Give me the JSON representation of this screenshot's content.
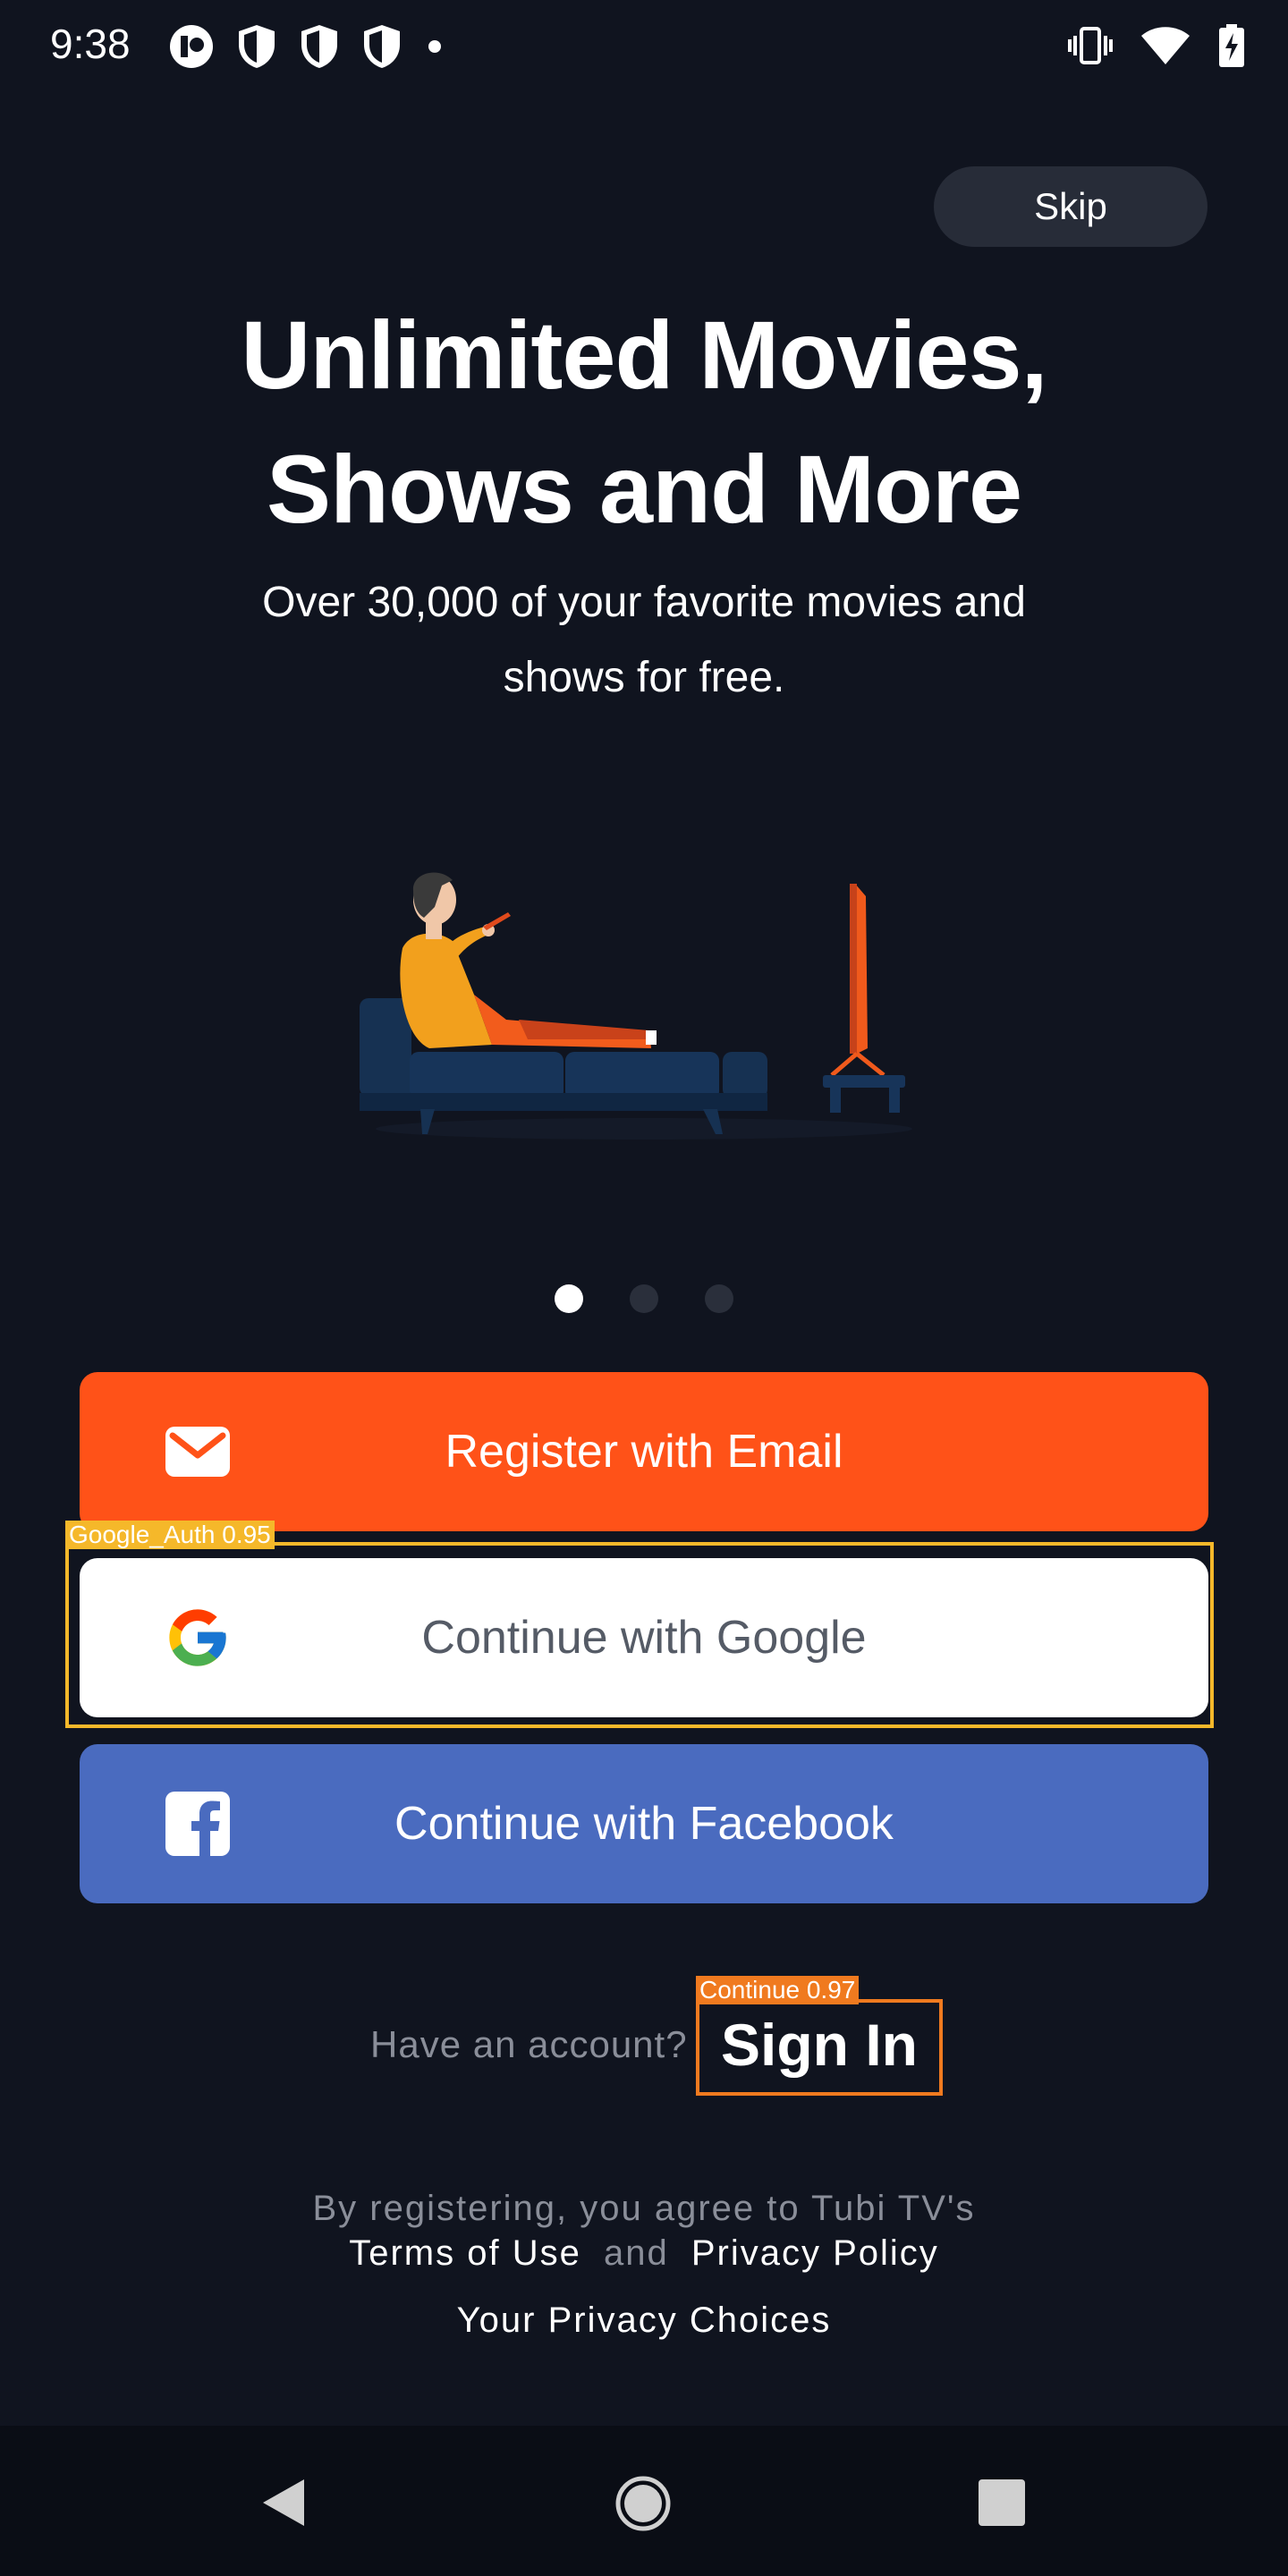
{
  "status_bar": {
    "time": "9:38",
    "left_icons": [
      "app-notification-icon",
      "shield-icon",
      "shield-icon",
      "shield-icon",
      "dot-icon"
    ],
    "right_icons": [
      "vibrate-icon",
      "wifi-icon",
      "battery-charging-icon"
    ]
  },
  "skip_label": "Skip",
  "headline": {
    "line1": "Unlimited Movies,",
    "line2": "Shows and More"
  },
  "subline": {
    "line1": "Over 30,000 of your favorite movies and",
    "line2": "shows for free."
  },
  "carousel": {
    "page_count": 3,
    "active_index": 0
  },
  "buttons": {
    "email": {
      "label": "Register with Email",
      "icon": "mail-icon",
      "color": "#ff5218"
    },
    "google": {
      "label": "Continue with Google",
      "icon": "google-icon",
      "color": "#ffffff"
    },
    "facebook": {
      "label": "Continue with Facebook",
      "icon": "facebook-icon",
      "color": "#4a6bbf"
    }
  },
  "detections": {
    "google": {
      "label": "Google_Auth 0.95",
      "color": "#f5b82a"
    },
    "sign_in": {
      "label": "Continue 0.97",
      "color": "#f07a1f"
    }
  },
  "account": {
    "prompt": "Have an account?",
    "sign_in": "Sign In"
  },
  "legal": {
    "line1": "By registering, you agree to Tubi TV's",
    "terms": "Terms of Use",
    "and": "and",
    "privacy": "Privacy Policy",
    "choices": "Your Privacy Choices"
  },
  "nav_bar": {
    "icons": [
      "back-icon",
      "home-icon",
      "recents-icon"
    ]
  }
}
